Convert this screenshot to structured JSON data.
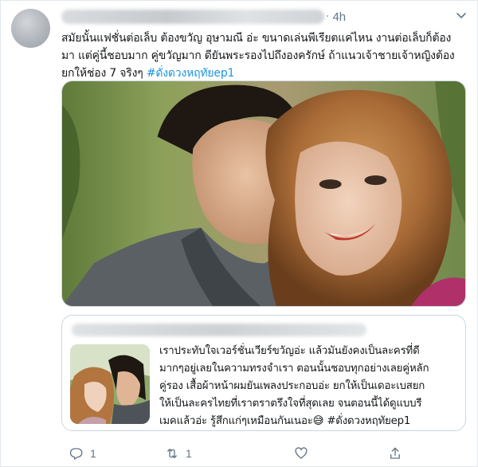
{
  "tweet": {
    "time_separator": "·",
    "time": "4h",
    "text_lines": [
      "สมัยนั้นแฟชั่นต่อเล็บ ต้องขวัญ อุษามณี อ่ะ ขนาดเล่นพีเรียตแค่ไหน งานต่อเล็บก็ต้อง",
      "มา แต่คู่นี้ชอบมาก คู่ขวัญมาก ดียันพระรองไปถึงองครักษ์ ถ้าแนวเจ้าชายเจ้าหญิงต้อง",
      "ยกให้ช่อง 7 จริงๆ "
    ],
    "hashtag": "#ดั่งดวงหฤทัยep1"
  },
  "quote": {
    "text_lines": [
      "เราประทับใจเวอร์ชั่นเวียร์ขวัญอ่ะ แล้วมันยังคงเป็นละครที่ดี",
      "มากๆอยู่เลยในความทรงจำเรา ตอนนั้นชอบทุกอย่างเลยคู่หลัก",
      "คู่รอง เสื้อผ้าหน้าผมยันเพลงประกอบอ่ะ ยกให้เป็นเดอะเบสยก",
      "ให้เป็นละครไทยที่เราตราตรึงใจที่สุดเลย จนตอนนี้ได้ดูแบบรี",
      "เมคแล้วอ่ะ รู้สึกแก่ๆเหมือนกันเนอะ😅 "
    ],
    "hashtag": "#ดั่งดวงหฤทัยep1"
  },
  "actions": {
    "reply_count": "1",
    "retweet_count": "1",
    "like_count": "",
    "share_label": ""
  },
  "icons": {
    "menu": "chevron-down-icon",
    "reply": "reply-icon",
    "retweet": "retweet-icon",
    "like": "heart-icon",
    "share": "share-icon"
  },
  "colors": {
    "hashtag": "#1b95e0",
    "secondary_text": "#657786",
    "border": "#ccd6dd"
  }
}
